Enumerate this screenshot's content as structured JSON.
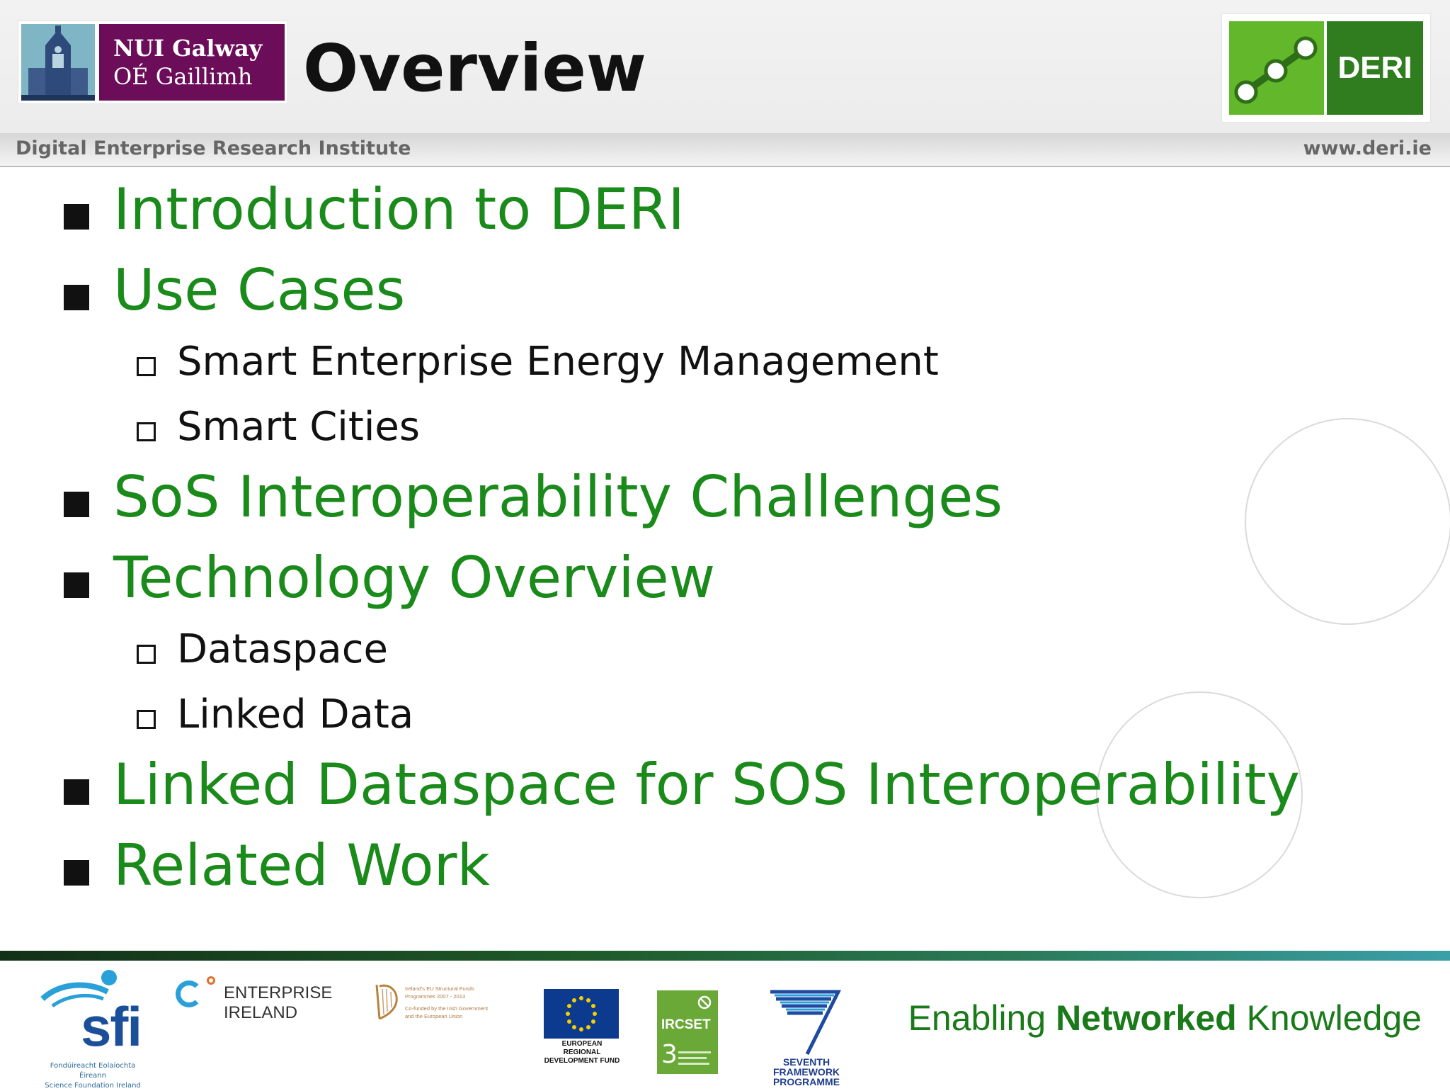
{
  "header": {
    "university_line1": "NUI Galway",
    "university_line2": "OÉ Gaillimh",
    "title": "Overview",
    "deri_logo_text": "DERI",
    "institute": "Digital Enterprise Research Institute",
    "website": "www.deri.ie"
  },
  "outline": [
    {
      "level": 1,
      "text": "Introduction to DERI"
    },
    {
      "level": 1,
      "text": "Use Cases"
    },
    {
      "level": 2,
      "text": "Smart Enterprise Energy Management"
    },
    {
      "level": 2,
      "text": "Smart Cities"
    },
    {
      "level": 1,
      "text": "SoS Interoperability Challenges"
    },
    {
      "level": 1,
      "text": "Technology Overview"
    },
    {
      "level": 2,
      "text": "Dataspace"
    },
    {
      "level": 2,
      "text": "Linked Data"
    },
    {
      "level": 1,
      "text": "Linked Dataspace for SOS Interoperability"
    },
    {
      "level": 1,
      "text": "Related Work"
    }
  ],
  "footer": {
    "sfi": "sfi",
    "sfi_caption_1": "Fondúireacht Eolaíochta Éireann",
    "sfi_caption_2": "Science Foundation Ireland",
    "enterprise_1": "ENTERPRISE",
    "enterprise_2": "IRELAND",
    "structural_funds_1": "Ireland's EU Structural Funds",
    "structural_funds_2": "Programmes 2007 - 2013",
    "structural_funds_3": "Co-funded by the Irish Government",
    "structural_funds_4": "and the European Union",
    "erdf_1": "EUROPEAN REGIONAL",
    "erdf_2": "DEVELOPMENT FUND",
    "ircset": "IRCSET",
    "fp7_1": "SEVENTH FRAMEWORK",
    "fp7_2": "PROGRAMME",
    "tagline_pre": "Enabling ",
    "tagline_bold": "Networked",
    "tagline_post": " Knowledge"
  },
  "colors": {
    "heading_green": "#1a8a1a",
    "nui_purple": "#6b0d58",
    "deri_green_light": "#62b82a",
    "deri_green_dark": "#2f7d1e"
  }
}
